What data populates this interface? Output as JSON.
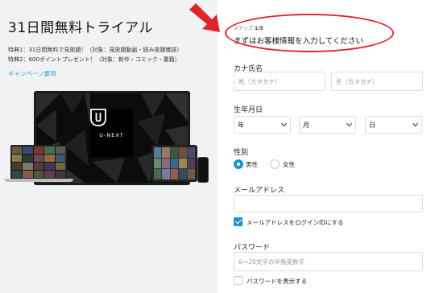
{
  "promo": {
    "title": "31日間無料トライアル",
    "perk1": "特典1：31日間無料で見放題！（対象：見放題動画・読み放題雑誌）",
    "perk2": "特典2：600ポイントプレゼント！（対象：新作・コミック・書籍）",
    "campaign_link": "キャンペーン要項",
    "logo_text": "U-NEXT"
  },
  "form": {
    "step_prefix": "ステップ",
    "step_value": "1/3",
    "headline": "まずはお客様情報を入力してください",
    "kana_label": "カナ氏名",
    "last_name_placeholder": "姓（カタカナ）",
    "first_name_placeholder": "名（カタカナ）",
    "birthdate_label": "生年月日",
    "year_value": "年",
    "month_value": "月",
    "day_value": "日",
    "gender_label": "性別",
    "gender_male": "男性",
    "gender_female": "女性",
    "email_label": "メールアドレス",
    "email_login_checkbox": "メールアドレスをログインIDにする",
    "password_label": "パスワード",
    "password_placeholder": "6～20文字の半角英数字",
    "show_password_checkbox": "パスワードを表示する"
  },
  "colors": {
    "accent": "#1a96d8",
    "annotation_red": "#e0242a",
    "link": "#29a4d6",
    "left_bg": "#f1f2f4"
  },
  "icons": [
    "u-next-shield-icon",
    "chevron-down-icon",
    "red-arrow-annotation"
  ]
}
